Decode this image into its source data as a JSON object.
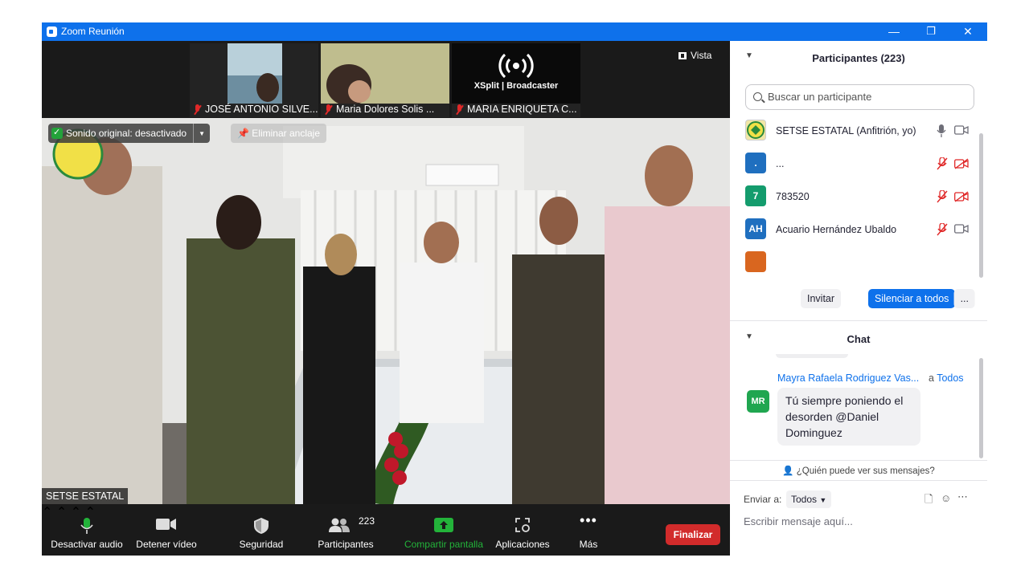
{
  "window": {
    "title": "Zoom Reunión",
    "minimize": "—",
    "restore": "❐",
    "close": "✕"
  },
  "thumbnails": [
    {
      "name": "JOSÉ ANTONIO SILVE..."
    },
    {
      "name": "Maria Dolores Solis ..."
    },
    {
      "name": "MARIA ENRIQUETA C...",
      "logo": "XSplit | Broadcaster"
    }
  ],
  "view_button": "Vista",
  "main_video": {
    "sound_status": "Sonido original: desactivado",
    "unpin": "Eliminar anclaje",
    "speaker_name": "SETSE ESTATAL"
  },
  "toolbar": {
    "audio": "Desactivar audio",
    "video": "Detener vídeo",
    "security": "Seguridad",
    "participants": "Participantes",
    "participants_count": "223",
    "share": "Compartir pantalla",
    "apps": "Aplicaciones",
    "more": "Más",
    "end": "Finalizar"
  },
  "participants_panel": {
    "title": "Participantes (223)",
    "search_placeholder": "Buscar un participante",
    "list": [
      {
        "initials": "",
        "name": "SETSE ESTATAL (Anfitrión, yo)",
        "color": "#f2e7a6",
        "muted": false,
        "video_on": true
      },
      {
        "initials": ".",
        "name": "...",
        "color": "#1f6fbf",
        "muted": true,
        "video_on": false
      },
      {
        "initials": "7",
        "name": "783520",
        "color": "#149c6d",
        "muted": true,
        "video_on": false
      },
      {
        "initials": "AH",
        "name": "Acuario Hernández Ubaldo",
        "color": "#1f6fbf",
        "muted": true,
        "video_on": true
      }
    ],
    "invite": "Invitar",
    "mute_all": "Silenciar a todos",
    "more": "..."
  },
  "chat_panel": {
    "title": "Chat",
    "sender": "Mayra Rafaela Rodriguez Vas...",
    "to_prefix": "a",
    "to": "Todos",
    "sender_initials": "MR",
    "message": "Tú siempre poniendo el desorden @Daniel Dominguez",
    "who_sees": "¿Quién puede ver sus mensajes?",
    "send_to_label": "Enviar a:",
    "send_to_value": "Todos",
    "input_placeholder": "Escribir mensaje aquí..."
  },
  "colors": {
    "zoom_blue": "#0e71eb",
    "end_red": "#d22b2b",
    "share_green": "#23b33a"
  }
}
